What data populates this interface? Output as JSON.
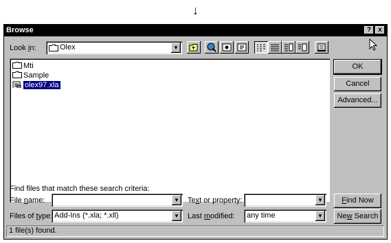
{
  "arrow": "↓",
  "window": {
    "title": "Browse",
    "help": "?",
    "close": "x"
  },
  "look_in": {
    "label_pre": "Look ",
    "label_key": "i",
    "label_post": "n:",
    "value": "Olex"
  },
  "files": [
    {
      "name": "Mti",
      "type": "folder"
    },
    {
      "name": "Sample",
      "type": "folder"
    },
    {
      "name": "olex97.xla",
      "type": "file",
      "selected": true
    }
  ],
  "buttons": {
    "ok": "OK",
    "cancel": "Cancel",
    "advanced": "Advanced...",
    "find_now_key": "F",
    "find_now_rest": "ind Now",
    "new_search_pre": "Ne",
    "new_search_key": "w",
    "new_search_rest": " Search"
  },
  "criteria": {
    "heading": "Find files that match these search criteria:",
    "file_name": {
      "pre": "File ",
      "key": "n",
      "post": "ame:",
      "value": ""
    },
    "files_of_type": {
      "pre": "Files of ",
      "key": "t",
      "post": "ype:",
      "value": "Add-Ins (*.xla; *.xll)"
    },
    "text_or_property": {
      "pre": "Te",
      "key": "x",
      "post": "t or property:",
      "value": ""
    },
    "last_modified": {
      "pre": "Last ",
      "key": "m",
      "post": "odified:",
      "value": "any time"
    }
  },
  "status": "1 file(s) found.",
  "icons": [
    "up-one-level-icon",
    "search-web-icon",
    "add-favorites-icon",
    "look-in-favorites-icon",
    "list-view-icon",
    "details-view-icon",
    "properties-view-icon",
    "preview-view-icon",
    "commands-settings-icon"
  ]
}
